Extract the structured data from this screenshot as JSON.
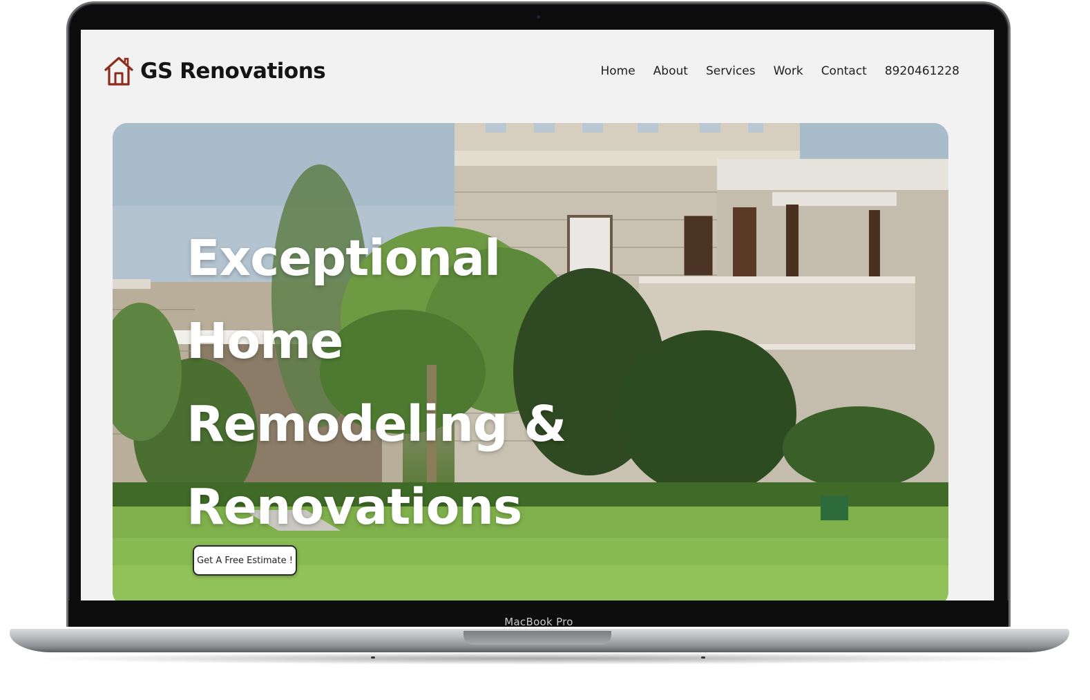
{
  "site": {
    "brand": "GS Renovations",
    "logo_icon": "house-outline-icon",
    "brand_color": "#8b2c1f"
  },
  "nav": {
    "items": [
      {
        "label": "Home"
      },
      {
        "label": "About"
      },
      {
        "label": "Services"
      },
      {
        "label": "Work"
      },
      {
        "label": "Contact"
      }
    ],
    "phone": "8920461228"
  },
  "hero": {
    "title_lines": [
      "Exceptional",
      "Home",
      "Remodeling &",
      "Renovations"
    ],
    "cta_label": "Get A Free Estimate !"
  },
  "device": {
    "label": "MacBook Pro"
  }
}
